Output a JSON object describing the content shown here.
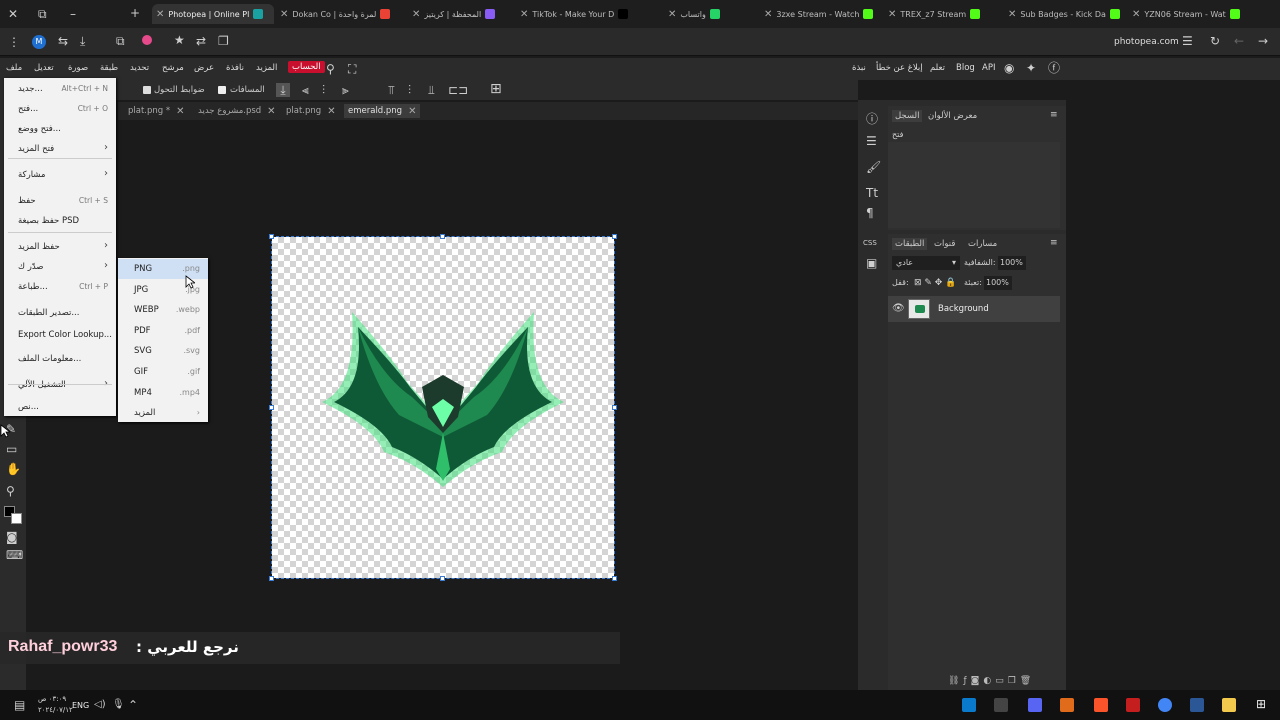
{
  "browser": {
    "tabs": [
      {
        "label": "Photopea | Online Pl",
        "color": "#1aa1a1",
        "active": true
      },
      {
        "label": "Dokan Co | لمرة واحدة",
        "color": "#ea4335"
      },
      {
        "label": "المحفظة | كريتيز",
        "color": "#8a5cf6"
      },
      {
        "label": "TikTok - Make Your D",
        "color": "#000000"
      },
      {
        "label": "واتساب",
        "color": "#25d366"
      },
      {
        "label": "3zxe Stream - Watch",
        "color": "#53fc18"
      },
      {
        "label": "TREX_z7 Stream",
        "color": "#53fc18"
      },
      {
        "label": "Sub Badges - Kick Da",
        "color": "#53fc18"
      },
      {
        "label": "YZN06 Stream - Wat",
        "color": "#53fc18"
      }
    ],
    "url": "photopea.com"
  },
  "menubar": {
    "items": [
      "ملف",
      "تعديل",
      "صورة",
      "طبقة",
      "تحديد",
      "مرشح",
      "عرض",
      "نافذة",
      "المزيد",
      "الحساب"
    ],
    "right": [
      "نبذة",
      "إبلاغ عن خطأ",
      "تعلم",
      "Blog",
      "API"
    ]
  },
  "options": {
    "transform_controls": "ضوابط التحول",
    "distances": "المسافات"
  },
  "doc_tabs": [
    "plat.png *",
    "مشروع جديد.psd",
    "plat.png",
    "emerald.png"
  ],
  "file_menu": [
    {
      "label": "جديد...",
      "shortcut": "Alt+Ctrl + N"
    },
    {
      "label": "فتح...",
      "shortcut": "Ctrl + O"
    },
    {
      "label": "فتح ووضع..."
    },
    {
      "label": "فتح المزيد",
      "arrow": true
    },
    {
      "label": "مشاركة",
      "arrow": true
    },
    {
      "label": "حفظ",
      "shortcut": "Ctrl + S"
    },
    {
      "label": "حفظ بصيغة PSD"
    },
    {
      "label": "حفظ المزيد",
      "arrow": true
    },
    {
      "label": "صدّر ك",
      "arrow": true
    },
    {
      "label": "طباعة...",
      "shortcut": "Ctrl + P"
    },
    {
      "label": "تصدير الطبقات..."
    },
    {
      "label": "Export Color Lookup..."
    },
    {
      "label": "معلومات الملف..."
    },
    {
      "label": "التشغيل الآلي",
      "arrow": true
    },
    {
      "label": "نص..."
    }
  ],
  "export_submenu": [
    {
      "label": "PNG",
      "ext": ".png"
    },
    {
      "label": "JPG",
      "ext": ".jpg"
    },
    {
      "label": "WEBP",
      "ext": ".webp"
    },
    {
      "label": "PDF",
      "ext": ".pdf"
    },
    {
      "label": "SVG",
      "ext": ".svg"
    },
    {
      "label": "GIF",
      "ext": ".gif"
    },
    {
      "label": "MP4",
      "ext": ".mp4"
    },
    {
      "label": "المزيد",
      "ext": ""
    }
  ],
  "panels": {
    "history_tabs": [
      "السجل",
      "معرض الألوان"
    ],
    "history_item": "فتح",
    "layer_tabs": [
      "الطبقات",
      "قنوات",
      "مسارات"
    ],
    "blend_mode": "عادي",
    "opacity_label": "الشفافية:",
    "opacity": "100%",
    "fill_label": "تعبئة:",
    "fill": "100%",
    "lock_label": "قفل:",
    "layer_name": "Background"
  },
  "caption": {
    "name": "Rahaf_powr33",
    "text": ": نرجع للعربي"
  },
  "taskbar": {
    "lang": "ENG",
    "time": "٠٣:٠٩ ص",
    "date": "٢٠٢٤/٠٧/١٢"
  },
  "colors": {
    "accent": "#3a7bd5",
    "account_btn": "#c8102e"
  }
}
